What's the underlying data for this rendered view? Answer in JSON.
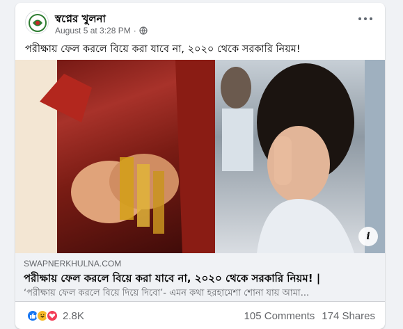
{
  "post": {
    "page_name": "স্বপ্নের খুলনা",
    "timestamp": "August 5 at 3:28 PM",
    "audience_icon": "globe-icon",
    "more_icon": "more-options-icon",
    "text": "পরীক্ষায় ফেল করলে বিয়ে করা যাবে না, ২০২০ থেকে সরকারি নিয়ম!"
  },
  "link_preview": {
    "domain": "SWAPNERKHULNA.COM",
    "title": "পরীক্ষায় ফেল করলে বিয়ে করা যাবে না, ২০২০ থেকে সরকারি নিয়ম! |",
    "description": "‘পরীক্ষায় ফেল করলে বিয়ে দিয়ে দিবো’- এমন কথা হরহামেশা শোনা যায় আমা...",
    "info_label": "i"
  },
  "engagement": {
    "reaction_icons": [
      "like-icon",
      "haha-icon",
      "love-icon"
    ],
    "reaction_count": "2.8K",
    "comments": "105 Comments",
    "shares": "174 Shares"
  },
  "colors": {
    "brand_blue": "#1877f2",
    "secondary_text": "#65676b",
    "background": "#f0f2f5"
  }
}
